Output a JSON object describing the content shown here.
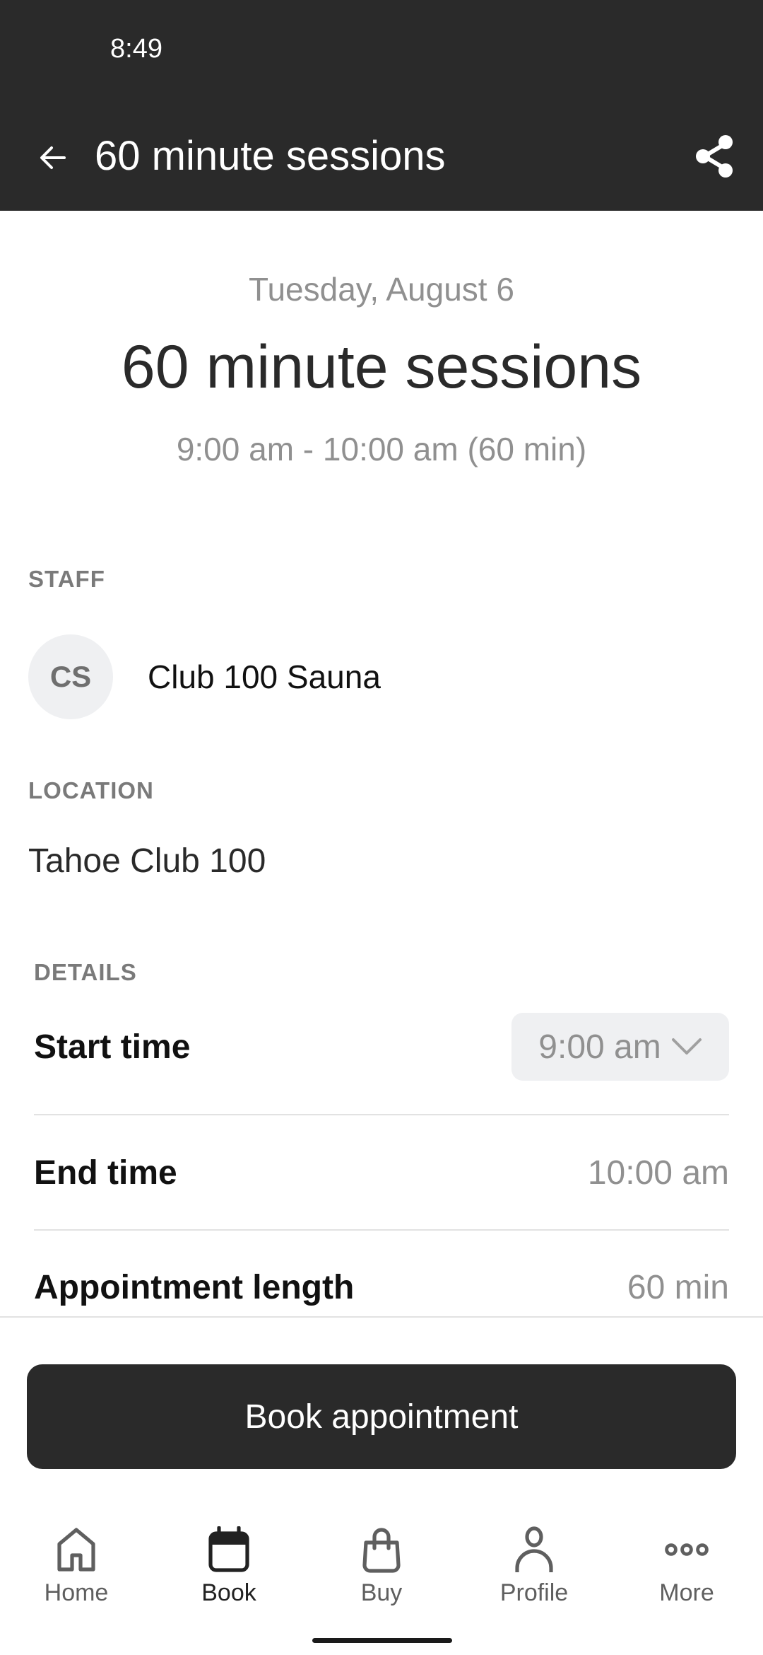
{
  "status_bar": {
    "time": "8:49"
  },
  "app_bar": {
    "title": "60 minute sessions",
    "back_icon": "arrow-left-icon",
    "share_icon": "share-icon"
  },
  "header": {
    "date": "Tuesday, August 6",
    "title": "60 minute sessions",
    "time_range": "9:00 am - 10:00 am (60 min)"
  },
  "staff": {
    "section_label": "STAFF",
    "initials": "CS",
    "name": "Club 100 Sauna"
  },
  "location": {
    "section_label": "LOCATION",
    "name": "Tahoe Club 100"
  },
  "details": {
    "section_label": "DETAILS",
    "rows": [
      {
        "label": "Start time",
        "value": "9:00 am",
        "type": "select"
      },
      {
        "label": "End time",
        "value": "10:00 am"
      },
      {
        "label": "Appointment length",
        "value": "60 min"
      }
    ]
  },
  "footer": {
    "book_button": "Book appointment"
  },
  "bottom_nav": {
    "active": "Book",
    "items": [
      {
        "label": "Home",
        "icon": "home-icon"
      },
      {
        "label": "Book",
        "icon": "calendar-icon"
      },
      {
        "label": "Buy",
        "icon": "shopping-bag-icon"
      },
      {
        "label": "Profile",
        "icon": "person-icon"
      },
      {
        "label": "More",
        "icon": "more-horizontal-icon"
      }
    ]
  },
  "colors": {
    "dark": "#2a2a2a",
    "muted_text": "#909090",
    "chip_bg": "#eff0f2"
  }
}
